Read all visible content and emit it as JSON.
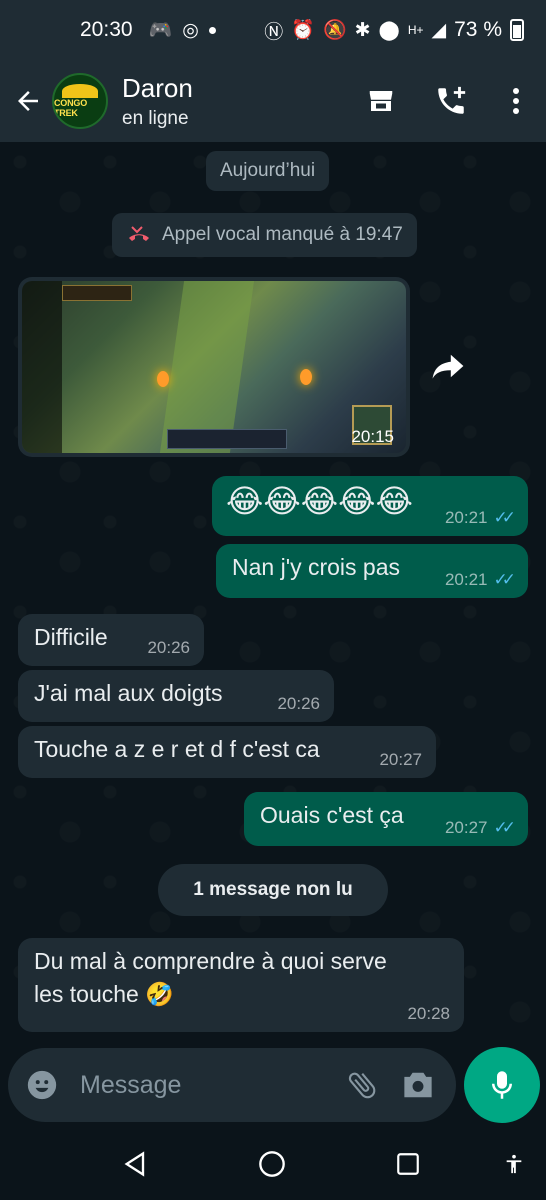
{
  "status_bar": {
    "time": "20:30",
    "battery": "73 %",
    "network": "H+"
  },
  "header": {
    "contact_name": "Daron",
    "contact_status": "en ligne",
    "avatar_text": "CONGO TREK"
  },
  "chat": {
    "date_label": "Aujourd’hui",
    "missed_call": "Appel vocal manqué à 19:47",
    "media_time": "20:15",
    "messages": [
      {
        "dir": "out",
        "text": "😂😂😂😂😂",
        "time": "20:21"
      },
      {
        "dir": "out",
        "text": "Nan j'y crois pas",
        "time": "20:21"
      },
      {
        "dir": "in",
        "text": "Difficile",
        "time": "20:26"
      },
      {
        "dir": "in",
        "text": "J'ai mal aux doigts",
        "time": "20:26"
      },
      {
        "dir": "in",
        "text": "Touche a z e r et d f c'est ca",
        "time": "20:27"
      },
      {
        "dir": "out",
        "text": "Ouais c'est ça",
        "time": "20:27"
      },
      {
        "dir": "in",
        "text_line1": "Du mal à comprendre à quoi serve",
        "text_line2": "les touche 🤣",
        "time": "20:28"
      }
    ],
    "unread_label": "1 message non lu"
  },
  "input": {
    "placeholder": "Message"
  },
  "colors": {
    "background": "#0b141a",
    "header": "#1f2c34",
    "bubble_in": "#1f2c34",
    "bubble_out": "#005c4b",
    "accent": "#00a884",
    "read_ticks": "#53bdeb"
  }
}
